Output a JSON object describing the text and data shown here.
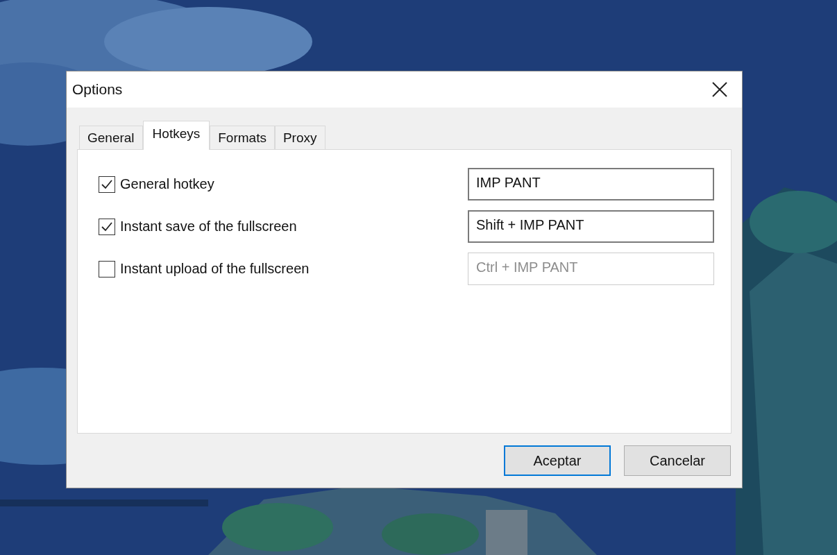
{
  "window": {
    "title": "Options"
  },
  "tabs": [
    {
      "label": "General",
      "selected": false
    },
    {
      "label": "Hotkeys",
      "selected": true
    },
    {
      "label": "Formats",
      "selected": false
    },
    {
      "label": "Proxy",
      "selected": false
    }
  ],
  "hotkeys": [
    {
      "label": "General hotkey",
      "checked": true,
      "value": "IMP PANT"
    },
    {
      "label": "Instant save of the fullscreen",
      "checked": true,
      "value": "Shift + IMP PANT"
    },
    {
      "label": "Instant upload of the fullscreen",
      "checked": false,
      "value": "Ctrl + IMP PANT"
    }
  ],
  "buttons": [
    {
      "label": "Aceptar",
      "default": true
    },
    {
      "label": "Cancelar",
      "default": false
    }
  ]
}
